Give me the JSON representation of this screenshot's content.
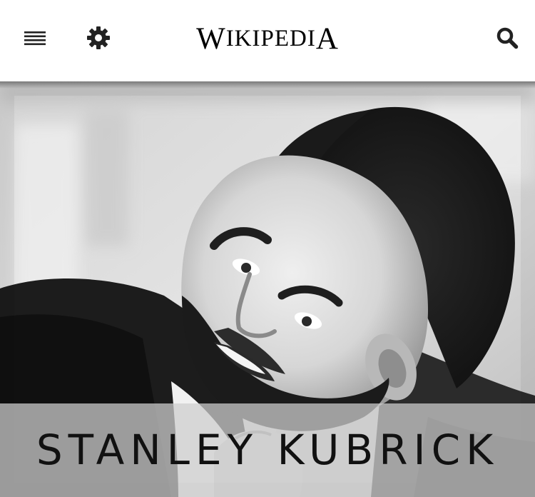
{
  "header": {
    "menu_icon": "hamburger-menu-icon",
    "settings_icon": "gear-icon",
    "search_icon": "search-icon",
    "wordmark": {
      "text": "Wikipedia",
      "first": "W",
      "middle": "IKIPEDI",
      "last": "A"
    }
  },
  "hero": {
    "image": "black-and-white portrait photograph",
    "title": "STANLEY KUBRICK"
  },
  "colors": {
    "header_bg": "#ffffff",
    "icon": "#222222",
    "title_band": "#cdcdcd",
    "title_text": "#111111"
  }
}
